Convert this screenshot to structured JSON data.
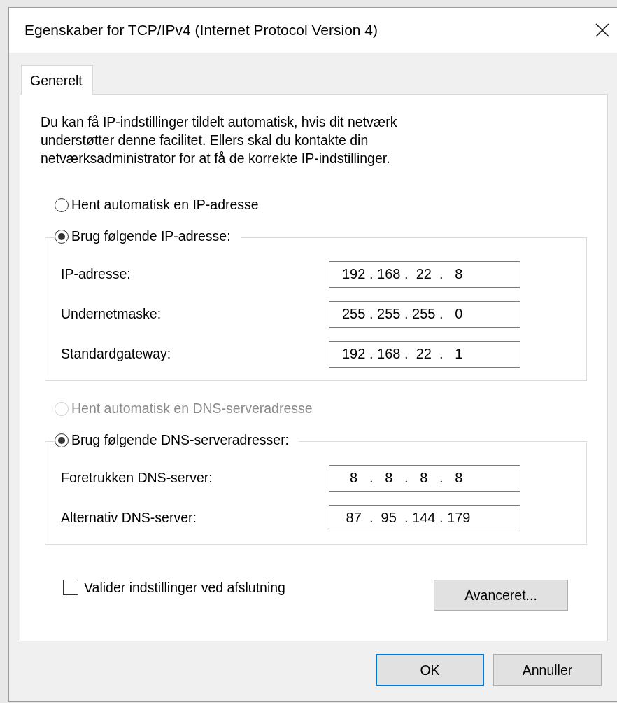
{
  "window": {
    "title": "Egenskaber for TCP/IPv4 (Internet Protocol Version 4)"
  },
  "tabs": [
    {
      "label": "Generelt",
      "selected": true
    }
  ],
  "description": "Du kan få IP-indstillinger tildelt automatisk, hvis dit netværk understøtter denne facilitet. Ellers skal du kontakte din netværksadministrator for at få de korrekte IP-indstillinger.",
  "sections": [
    {
      "auto": {
        "label": "Hent automatisk en IP-adresse",
        "selected": false,
        "disabled": false
      },
      "manual": {
        "label": "Brug følgende IP-adresse:",
        "selected": true,
        "disabled": false
      },
      "fields": [
        {
          "label": "IP-adresse:",
          "value": "192 . 168 .  22  .   8"
        },
        {
          "label": "Undernetmaske:",
          "value": "255 . 255 . 255 .   0"
        },
        {
          "label": "Standardgateway:",
          "value": "192 . 168 .  22  .   1"
        }
      ]
    },
    {
      "auto": {
        "label": "Hent automatisk en DNS-serveradresse",
        "selected": false,
        "disabled": true
      },
      "manual": {
        "label": "Brug følgende DNS-serveradresser:",
        "selected": true,
        "disabled": false
      },
      "fields": [
        {
          "label": "Foretrukken DNS-server:",
          "value": "  8   .   8   .   8   .   8"
        },
        {
          "label": "Alternativ DNS-server:",
          "value": " 87  .  95  . 144 . 179"
        }
      ]
    }
  ],
  "validate": {
    "label": "Valider indstillinger ved afslutning",
    "checked": false
  },
  "advanced_button": {
    "label": "Avanceret..."
  },
  "buttons": [
    {
      "label": "OK",
      "default": true
    },
    {
      "label": "Annuller",
      "default": false
    }
  ]
}
